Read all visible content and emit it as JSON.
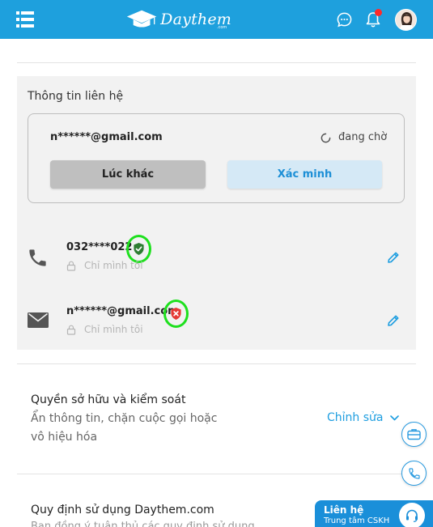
{
  "header": {
    "logo_text": "Daythem",
    "logo_sub": ".com",
    "has_notification": true,
    "brand_color": "#1ea0dd"
  },
  "contact_panel": {
    "title": "Thông tin liên hệ",
    "verification": {
      "email": "n******@gmail.com",
      "status": "đang chờ",
      "later_label": "Lúc khác",
      "verify_label": "Xác minh"
    },
    "items": [
      {
        "icon": "phone-icon",
        "value": "032****022",
        "privacy": "Chỉ mình tôi",
        "badge": "shield-check-icon",
        "badge_color": "#2e7d32"
      },
      {
        "icon": "mail-icon",
        "value": "n******@gmail.com",
        "privacy": "Chỉ mình tôi",
        "badge": "shield-x-icon",
        "badge_color": "#e53935"
      }
    ]
  },
  "ownership": {
    "title": "Quyền sở hữu và kiểm soát",
    "description": "Ẩn thông tin, chặn cuộc gọi hoặc vô hiệu hóa",
    "edit_label": "Chỉnh sửa"
  },
  "policy": {
    "title": "Quy định sử dụng Daythem.com",
    "subtitle": "Bạn đồng ý tuân thủ các quy định sử dụng..."
  },
  "support": {
    "title": "Liên hệ",
    "subtitle": "Trung tâm CSKH"
  },
  "accent_color": "#1e9ee0"
}
